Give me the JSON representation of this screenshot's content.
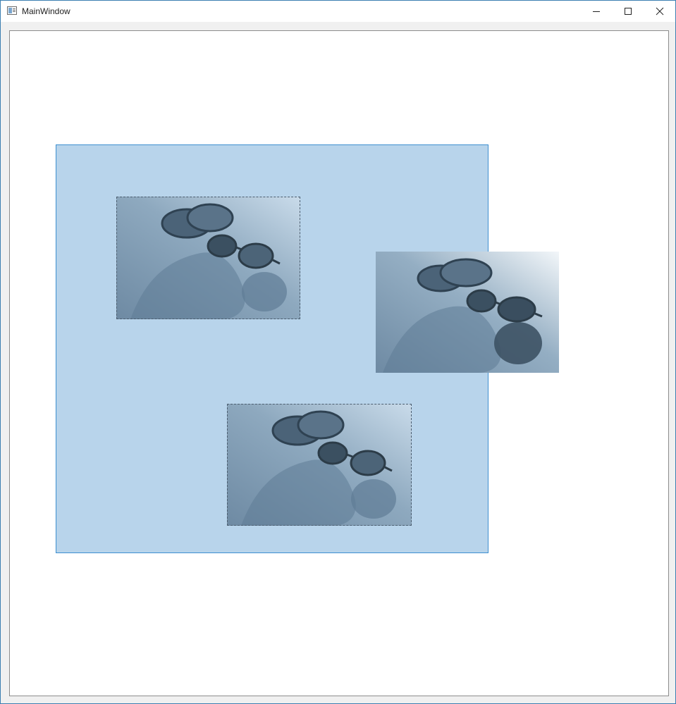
{
  "window": {
    "title": "MainWindow",
    "controls": {
      "minimize_icon": "minimize-icon",
      "maximize_icon": "maximize-icon",
      "close_icon": "close-icon"
    }
  },
  "canvas": {
    "selection_color": "#b8d4eb",
    "selection_border_color": "#3d8fd0",
    "items": [
      {
        "name": "photo-sunglasses-1",
        "state": "selected"
      },
      {
        "name": "photo-sunglasses-2",
        "state": "dragging"
      },
      {
        "name": "photo-sunglasses-3",
        "state": "selected"
      }
    ]
  }
}
